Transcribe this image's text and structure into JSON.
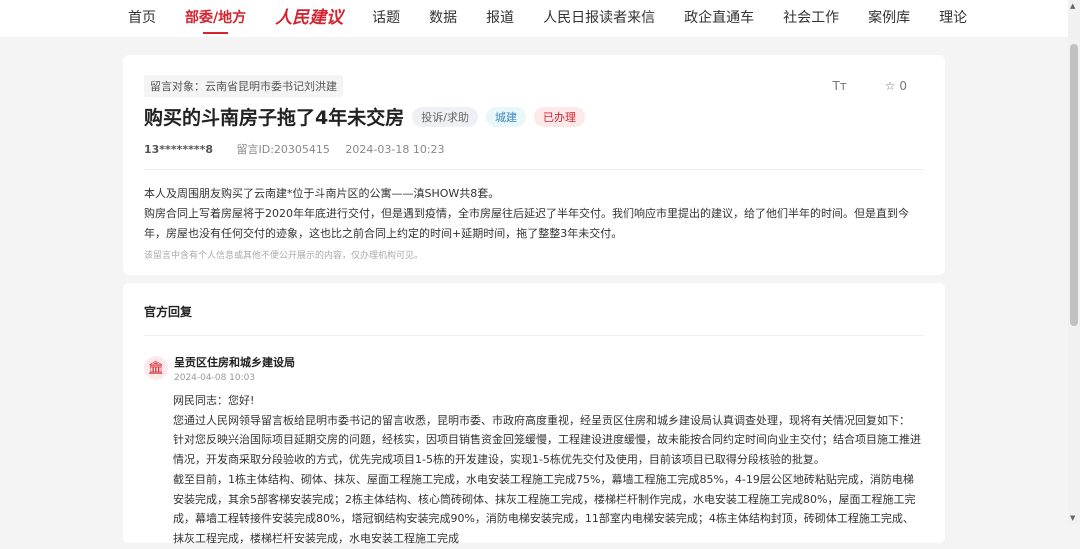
{
  "nav": {
    "items": [
      "首页",
      "部委/地方",
      "人民建议",
      "话题",
      "数据",
      "报道",
      "人民日报读者来信",
      "政企直通车",
      "社会工作",
      "案例库",
      "理论"
    ]
  },
  "message": {
    "target": "留言对象：云南省昆明市委书记刘洪建",
    "font_tool": "Tт",
    "favorites": "☆ 0",
    "title": "购买的斗南房子拖了4年未交房",
    "tags": [
      "投诉/求助",
      "城建",
      "已办理"
    ],
    "author": "13********8",
    "id": "留言ID:20305415",
    "time": "2024-03-18 10:23",
    "paragraphs": [
      "本人及周围朋友购买了云南建*位于斗南片区的公寓——滇SHOW共8套。",
      "购房合同上写着房屋将于2020年年底进行交付，但是遇到疫情，全市房屋往后延迟了半年交付。我们响应市里提出的建议，给了他们半年的时间。但是直到今年，房屋也没有任何交付的迹象，这也比之前合同上约定的时间+延期时间，拖了整整3年未交付。"
    ],
    "note": "该留言中含有个人信息或其他不便公开展示的内容，仅办理机构可见。"
  },
  "reply": {
    "heading": "官方回复",
    "dept": "呈贡区住房和城乡建设局",
    "time": "2024-04-08 10:03",
    "paragraphs": [
      "网民同志：您好!",
      "您通过人民网领导留言板给昆明市委书记的留言收悉，昆明市委、市政府高度重视，经呈贡区住房和城乡建设局认真调查处理，现将有关情况回复如下：",
      "针对您反映兴治国际项目延期交房的问题，经核实，因项目销售资金回笼缓慢，工程建设进度缓慢，故未能按合同约定时间向业主交付；结合项目施工推进情况，开发商采取分段验收的方式，优先完成项目1-5栋的开发建设，实现1-5栋优先交付及使用，目前该项目已取得分段核验的批复。",
      "截至目前，1栋主体结构、砌体、抹灰、屋面工程施工完成，水电安装工程施工完成75%，幕墙工程施工完成85%，4-19层公区地砖粘贴完成，消防电梯安装完成，其余5部客梯安装完成；2栋主体结构、核心筒砖砌体、抹灰工程施工完成，楼梯栏杆制作完成，水电安装工程施工完成80%，屋面工程施工完成，幕墙工程转接件安装完成80%，塔冠钢结构安装完成90%，消防电梯安装完成，11部室内电梯安装完成；4栋主体结构封顶，砖砌体工程施工完成、抹灰工程完成，楼梯栏杆安装完成，水电安装工程施工完成"
    ]
  }
}
